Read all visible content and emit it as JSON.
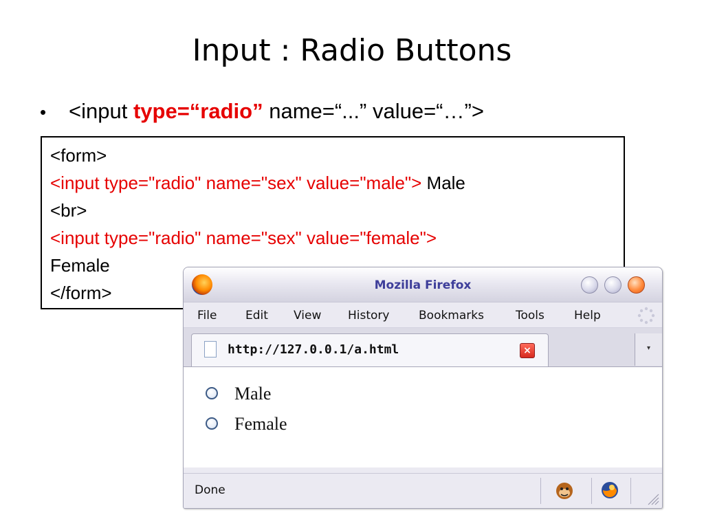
{
  "slide": {
    "title": "Input : Radio Buttons",
    "bullet": {
      "symbol": "•",
      "prefix": "<input ",
      "highlight": "type=“radio”",
      "suffix": " name=“...” value=“…”>"
    },
    "code": {
      "line1": "<form>",
      "line2_red": "<input  type=\"radio\"  name=\"sex\"  value=\"male\">",
      "line2_text": " Male",
      "line3": "<br>",
      "line4_red": "<input  type=\"radio\"  name=\"sex\"  value=\"female\">",
      "line5": "Female",
      "line6": "</form>"
    },
    "colors": {
      "highlight": "#e60000"
    }
  },
  "browser": {
    "title": "Mozilla Firefox",
    "menu": [
      "File",
      "Edit",
      "View",
      "History",
      "Bookmarks",
      "Tools",
      "Help"
    ],
    "tab": {
      "label": "http://127.0.0.1/a.html",
      "close_glyph": "×"
    },
    "tab_list_glyph": "▾",
    "content": {
      "radios": [
        {
          "label": "Male",
          "checked": false
        },
        {
          "label": "Female",
          "checked": false
        }
      ]
    },
    "status": {
      "text": "Done"
    },
    "icons": {
      "app": "firefox-logo-icon",
      "minimize": "minimize-icon",
      "maximize": "maximize-icon",
      "close": "close-icon",
      "throbber": "throbber-icon",
      "page": "page-icon",
      "addon": "greasemonkey-icon",
      "status_firefox": "firefox-logo-icon",
      "resize": "resize-grip-icon"
    }
  }
}
